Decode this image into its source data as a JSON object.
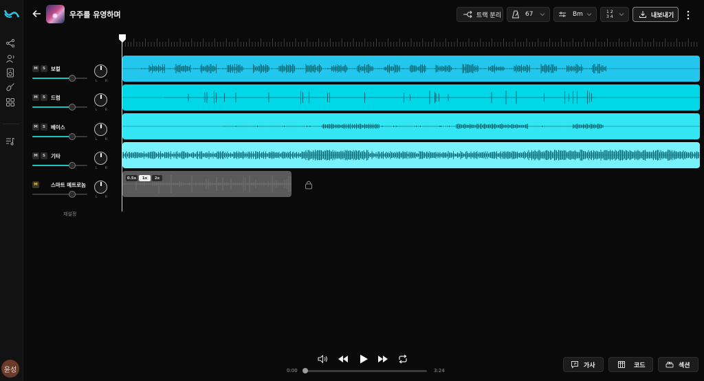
{
  "header": {
    "song_title": "우주를 유영하며",
    "track_split_label": "트랙 분리",
    "tempo": "67",
    "key": "Bm",
    "time_sig_top": "1 2",
    "time_sig_bottom": "3 4",
    "export_label": "내보내기"
  },
  "tracks": [
    {
      "name": "보컬",
      "volume": 0.72,
      "color": "#23c6ec"
    },
    {
      "name": "드럼",
      "volume": 0.72,
      "color": "#00d8e8"
    },
    {
      "name": "베이스",
      "volume": 0.72,
      "color": "#33e6f4"
    },
    {
      "name": "기타",
      "volume": 0.72,
      "color": "#77f1fc"
    },
    {
      "name": "스마트 메트로놈",
      "volume": 0.72,
      "color": "#5a5a5a"
    }
  ],
  "track_buttons": {
    "mute": "M",
    "solo": "S"
  },
  "pan_labels": {
    "left": "L",
    "right": "R"
  },
  "reset_label": "재설정",
  "metronome_speeds": [
    "0.5x",
    "1x",
    "2x"
  ],
  "metronome_selected_speed": "1x",
  "player": {
    "current_time": "0:00",
    "total_time": "3:24",
    "progress": 0.0
  },
  "bottom_buttons": {
    "lyrics": "가사",
    "chords": "코드",
    "sections": "섹션"
  },
  "user": {
    "avatar_text": "윤성"
  },
  "icons": {
    "logo": "wave-logo-icon",
    "rail": [
      "share-nodes-icon",
      "voice-user-icon",
      "speaker-icon",
      "guitar-icon",
      "grid-icon",
      "playlist-icon"
    ]
  }
}
